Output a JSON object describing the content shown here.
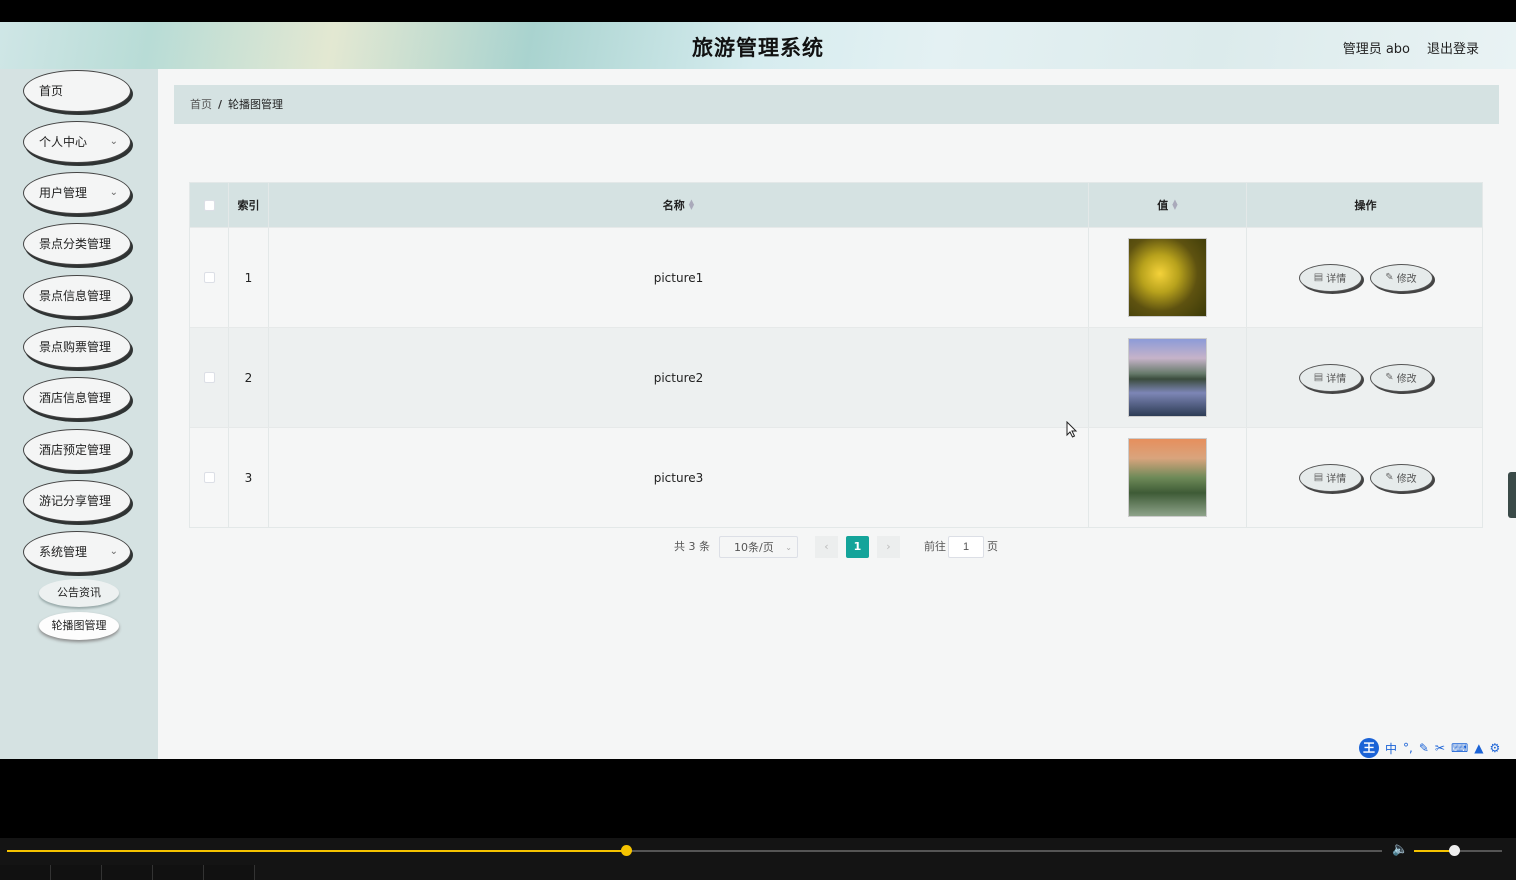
{
  "header": {
    "title": "旅游管理系统",
    "user": "管理员 abo",
    "logout": "退出登录"
  },
  "sidebar": {
    "items": [
      {
        "label": "首页",
        "has_sub": false
      },
      {
        "label": "个人中心",
        "has_sub": true
      },
      {
        "label": "用户管理",
        "has_sub": true
      },
      {
        "label": "景点分类管理",
        "has_sub": false
      },
      {
        "label": "景点信息管理",
        "has_sub": false
      },
      {
        "label": "景点购票管理",
        "has_sub": false
      },
      {
        "label": "酒店信息管理",
        "has_sub": false
      },
      {
        "label": "酒店预定管理",
        "has_sub": false
      },
      {
        "label": "游记分享管理",
        "has_sub": false
      },
      {
        "label": "系统管理",
        "has_sub": true
      }
    ],
    "sub_items": [
      {
        "label": "公告资讯",
        "active": false
      },
      {
        "label": "轮播图管理",
        "active": true
      }
    ],
    "chevron": "chevron-down-icon"
  },
  "breadcrumb": {
    "home": "首页",
    "separator": "/",
    "current": "轮播图管理"
  },
  "table": {
    "columns": {
      "index": "索引",
      "name": "名称",
      "value": "值",
      "ops": "操作"
    },
    "rows": [
      {
        "index": "1",
        "name": "picture1",
        "image": "yellow-flower-image"
      },
      {
        "index": "2",
        "name": "picture2",
        "image": "mountain-lake-image"
      },
      {
        "index": "3",
        "name": "picture3",
        "image": "sunset-island-image"
      }
    ],
    "detail_label": "详情",
    "edit_label": "修改"
  },
  "pagination": {
    "total": "共 3 条",
    "page_size": "10条/页",
    "current_page": "1",
    "goto_label": "前往",
    "goto_value": "1",
    "page_suffix": "页"
  },
  "ime": {
    "logo": "王",
    "mode": "中"
  },
  "player": {
    "progress": 0.45,
    "volume": 0.45
  },
  "colors": {
    "accent": "#14a49a",
    "sidebar_bg": "#d5e2e2",
    "progress": "#f5c300"
  }
}
